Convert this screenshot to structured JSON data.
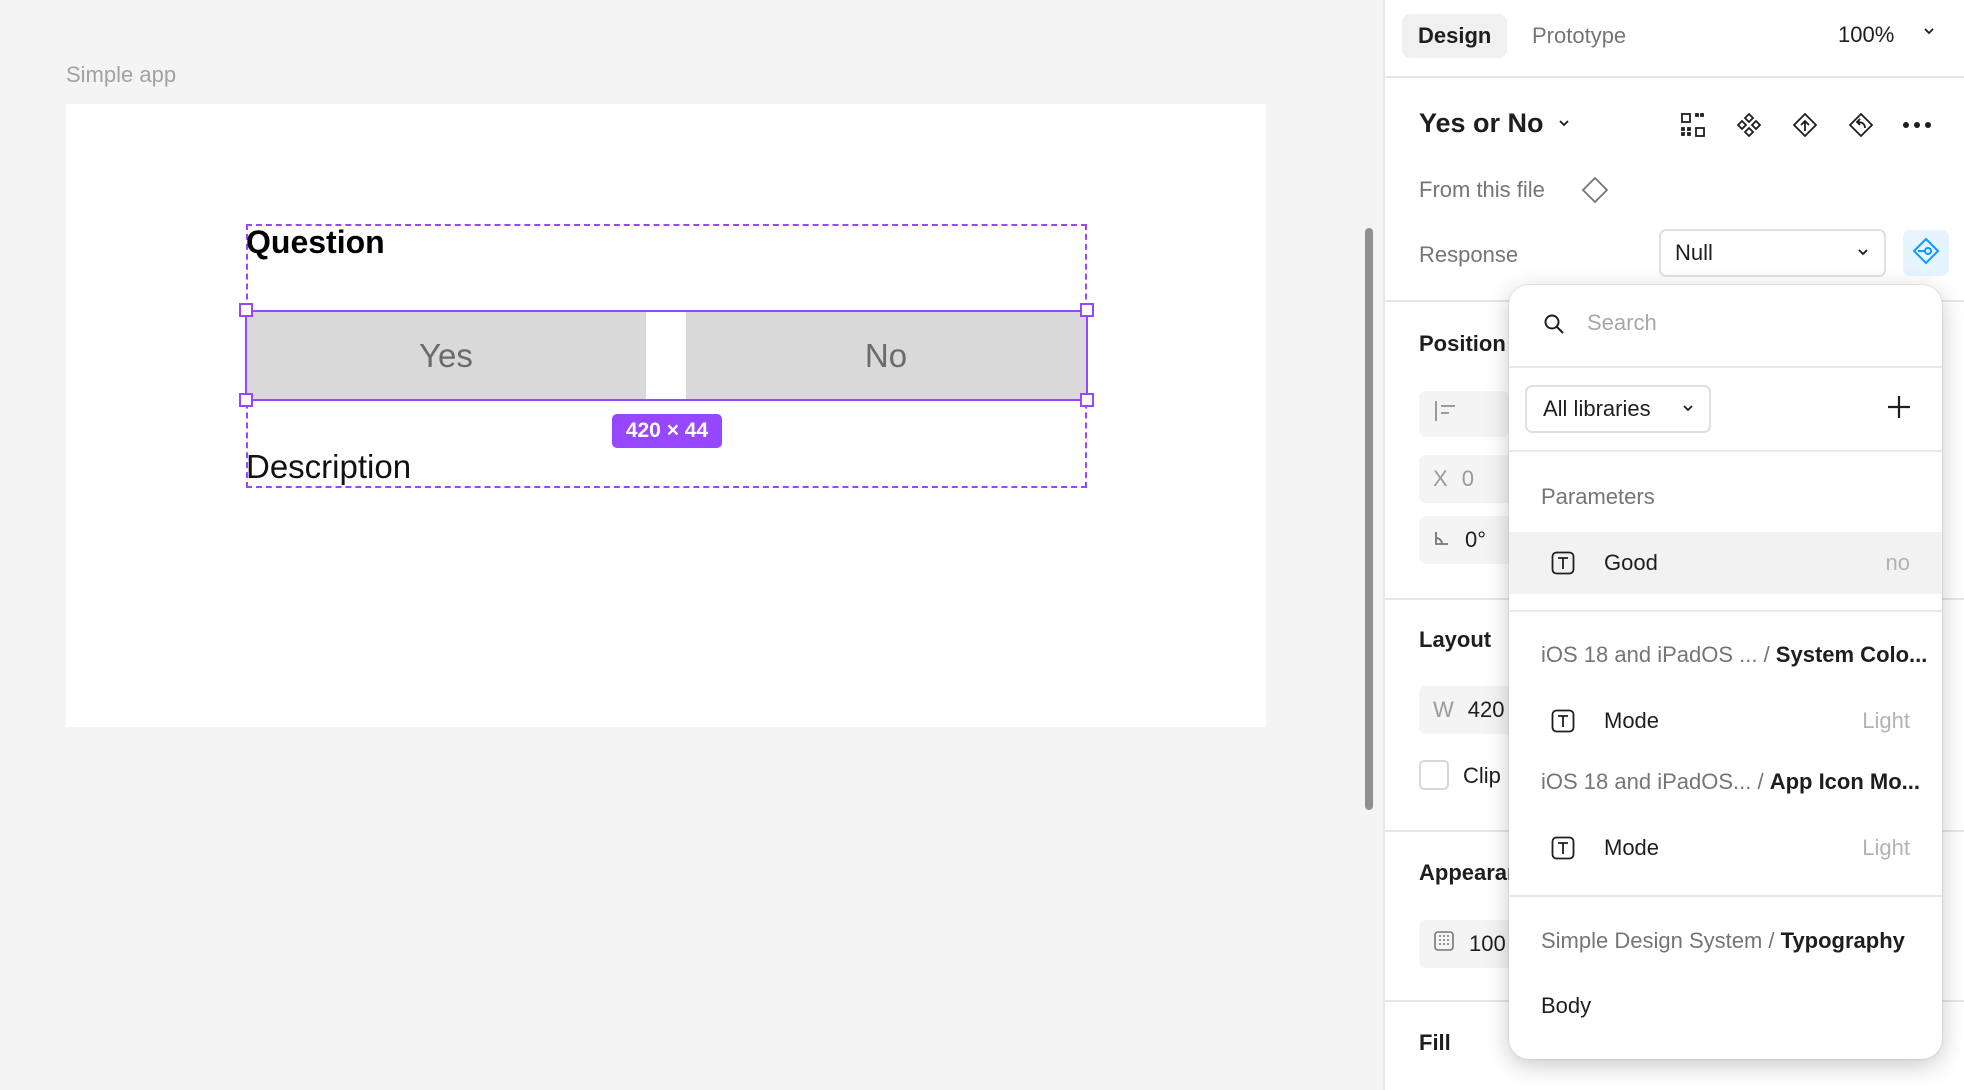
{
  "canvas": {
    "frame_name": "Simple app",
    "question": "Question",
    "yes": "Yes",
    "no": "No",
    "description": "Description",
    "size_badge": "420 × 44"
  },
  "panel": {
    "tabs": [
      "Design",
      "Prototype"
    ],
    "zoom": "100%",
    "component_name": "Yes or No",
    "from_file": "From this file",
    "response_label": "Response",
    "response_value": "Null",
    "sections": {
      "position": "Position",
      "x_label": "X",
      "x_value": "0",
      "rotation": "0°",
      "layout": "Layout",
      "w_label": "W",
      "w_value": "420",
      "clip": "Clip",
      "appearance": "Appearar",
      "opacity": "100",
      "fill": "Fill"
    }
  },
  "popover": {
    "search_placeholder": "Search",
    "library_select": "All libraries",
    "groups": [
      {
        "muted": "Parameters",
        "strong": "",
        "items": [
          {
            "name": "Good",
            "value": "no",
            "highlighted": true
          }
        ]
      },
      {
        "muted": "iOS 18 and iPadOS ... / ",
        "strong": "System Colo...",
        "items": [
          {
            "name": "Mode",
            "value": "Light"
          }
        ]
      },
      {
        "muted": "iOS 18 and iPadOS... / ",
        "strong": "App Icon Mo...",
        "items": [
          {
            "name": "Mode",
            "value": "Light"
          }
        ]
      },
      {
        "muted": "Simple Design System / ",
        "strong": "Typography",
        "items": [
          {
            "name": "Body",
            "value": ""
          }
        ]
      }
    ]
  },
  "colors": {
    "selection": "#9747ff",
    "accent_blue": "#0d99ff"
  }
}
